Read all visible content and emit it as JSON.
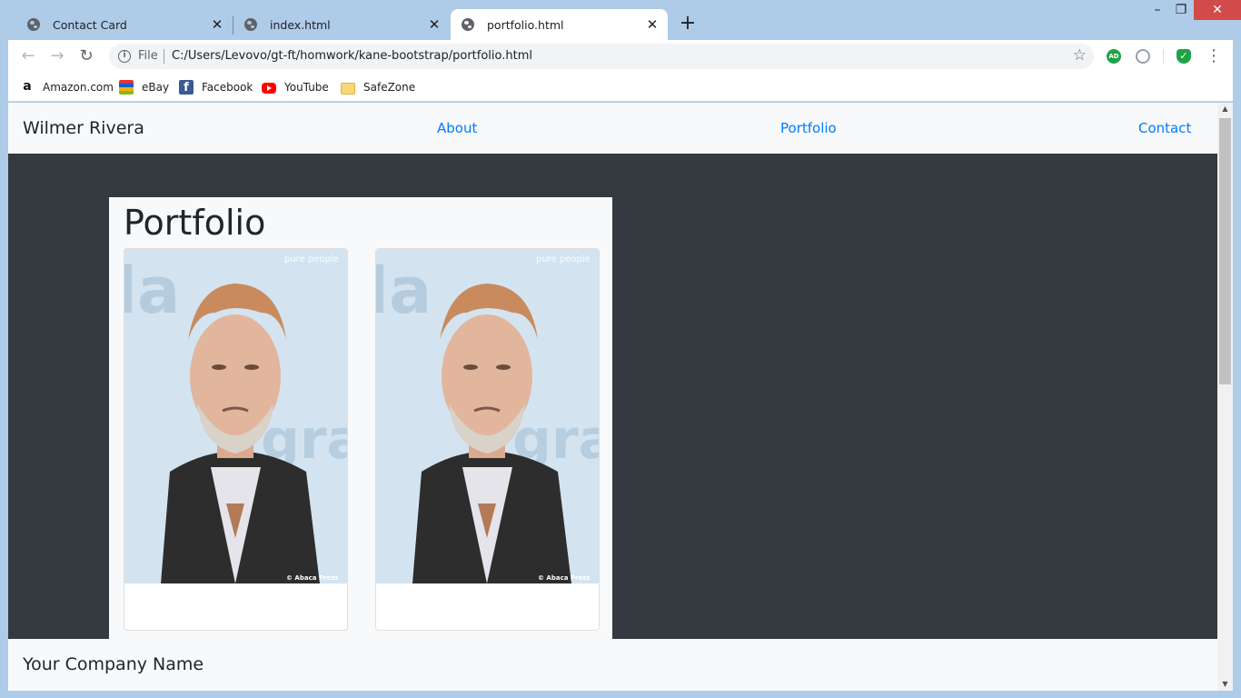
{
  "browser": {
    "tabs": [
      {
        "label": "Contact Card",
        "active": false
      },
      {
        "label": "index.html",
        "active": false
      },
      {
        "label": "portfolio.html",
        "active": true
      }
    ],
    "close_glyph": "✕",
    "new_tab_glyph": "+",
    "window_controls": {
      "minimize": "–",
      "maximize": "❐",
      "close": "✕"
    },
    "toolbar": {
      "back_glyph": "←",
      "forward_glyph": "→",
      "reload_glyph": "↻",
      "scheme_label": "File",
      "url": "C:/Users/Levovo/gt-ft/homwork/kane-bootstrap/portfolio.html",
      "star_glyph": "☆",
      "menu_glyph": "⋮",
      "extensions": [
        "adguard-icon",
        "cloud-icon",
        "shield-check-icon"
      ]
    },
    "bookmarks": [
      {
        "label": "Amazon.com",
        "icon": "amazon-icon"
      },
      {
        "label": "eBay",
        "icon": "ebay-icon"
      },
      {
        "label": "Facebook",
        "icon": "facebook-icon"
      },
      {
        "label": "YouTube",
        "icon": "youtube-icon"
      },
      {
        "label": "SafeZone",
        "icon": "folder-icon"
      }
    ]
  },
  "page": {
    "brand": "Wilmer Rivera",
    "nav": {
      "about": "About",
      "portfolio": "Portfolio",
      "contact": "Contact"
    },
    "heading": "Portfolio",
    "cards": [
      {
        "image": "portrait-photo",
        "watermark_top": "pure people",
        "watermark_bottom": "© Abaca Press"
      },
      {
        "image": "portrait-photo",
        "watermark_top": "pure people",
        "watermark_bottom": "© Abaca Press"
      }
    ],
    "footer": "Your Company Name"
  },
  "colors": {
    "chrome_frame": "#aecbe8",
    "page_dark": "#343a40",
    "page_light": "#f8f9fa",
    "link": "#007bff"
  }
}
